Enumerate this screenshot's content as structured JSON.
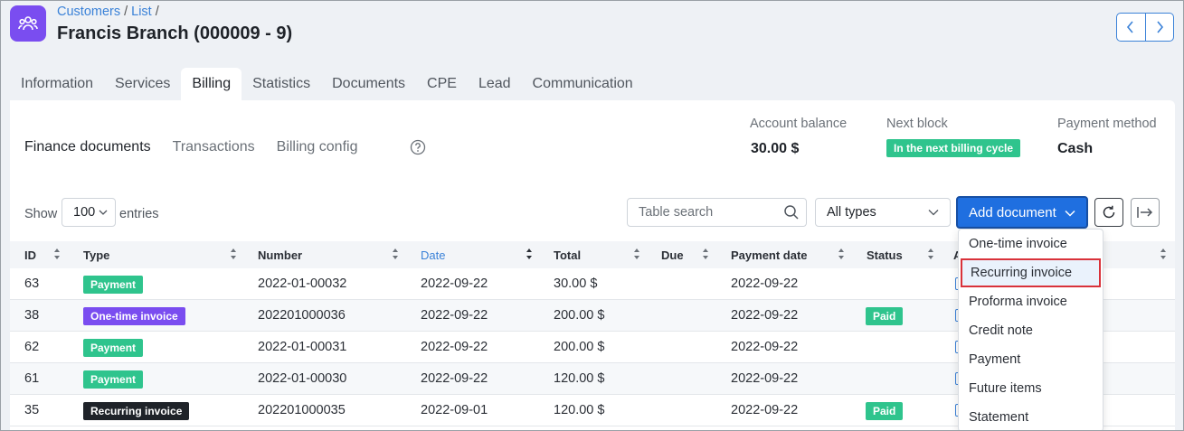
{
  "breadcrumb": {
    "customers": "Customers",
    "list": "List",
    "sep": "/"
  },
  "page_title": "Francis Branch (000009 - 9)",
  "colors": {
    "brand": "#7a4df0",
    "primary": "#1f6fe0",
    "success": "#2fc48d",
    "highlight": "#d9323a"
  },
  "tabs": [
    {
      "label": "Information"
    },
    {
      "label": "Services"
    },
    {
      "label": "Billing"
    },
    {
      "label": "Statistics"
    },
    {
      "label": "Documents"
    },
    {
      "label": "CPE"
    },
    {
      "label": "Lead"
    },
    {
      "label": "Communication"
    }
  ],
  "active_tab": "Billing",
  "subtabs": [
    {
      "label": "Finance documents"
    },
    {
      "label": "Transactions"
    },
    {
      "label": "Billing config"
    }
  ],
  "summary": {
    "account_balance_label": "Account balance",
    "account_balance_value": "30.00 $",
    "next_block_label": "Next block",
    "next_block_value": "In the next billing cycle",
    "payment_method_label": "Payment method",
    "payment_method_value": "Cash"
  },
  "controls": {
    "show_label": "Show",
    "entries_value": "100",
    "entries_label": "entries",
    "search_placeholder": "Table search",
    "types_value": "All types",
    "add_document_label": "Add document"
  },
  "table": {
    "columns": [
      "ID",
      "Type",
      "Number",
      "Date",
      "Total",
      "Due",
      "Payment date",
      "Status",
      "A"
    ],
    "rows": [
      {
        "id": "63",
        "type": "Payment",
        "number": "2022-01-00032",
        "date": "2022-09-22",
        "total": "30.00 $",
        "due": "",
        "payment_date": "2022-09-22",
        "status": ""
      },
      {
        "id": "38",
        "type": "One-time invoice",
        "number": "202201000036",
        "date": "2022-09-22",
        "total": "200.00 $",
        "due": "",
        "payment_date": "2022-09-22",
        "status": "Paid"
      },
      {
        "id": "62",
        "type": "Payment",
        "number": "2022-01-00031",
        "date": "2022-09-22",
        "total": "200.00 $",
        "due": "",
        "payment_date": "2022-09-22",
        "status": ""
      },
      {
        "id": "61",
        "type": "Payment",
        "number": "2022-01-00030",
        "date": "2022-09-22",
        "total": "120.00 $",
        "due": "",
        "payment_date": "2022-09-22",
        "status": ""
      },
      {
        "id": "35",
        "type": "Recurring invoice",
        "number": "202201000035",
        "date": "2022-09-01",
        "total": "120.00 $",
        "due": "",
        "payment_date": "2022-09-22",
        "status": "Paid"
      }
    ],
    "type_colors": {
      "Payment": "#2fc48d",
      "One-time invoice": "#7a4df0",
      "Recurring invoice": "#1f2329"
    }
  },
  "dropdown": {
    "items": [
      {
        "label": "One-time invoice"
      },
      {
        "label": "Recurring invoice",
        "highlighted": true
      },
      {
        "label": "Proforma invoice"
      },
      {
        "label": "Credit note"
      },
      {
        "label": "Payment"
      },
      {
        "label": "Future items"
      },
      {
        "label": "Statement"
      }
    ]
  },
  "icons": {
    "app": "customers-group-icon",
    "prev": "chevron-left-icon",
    "next": "chevron-right-icon",
    "help": "question-circle-icon",
    "search": "search-icon",
    "refresh": "refresh-icon",
    "export": "export-arrow-icon"
  }
}
